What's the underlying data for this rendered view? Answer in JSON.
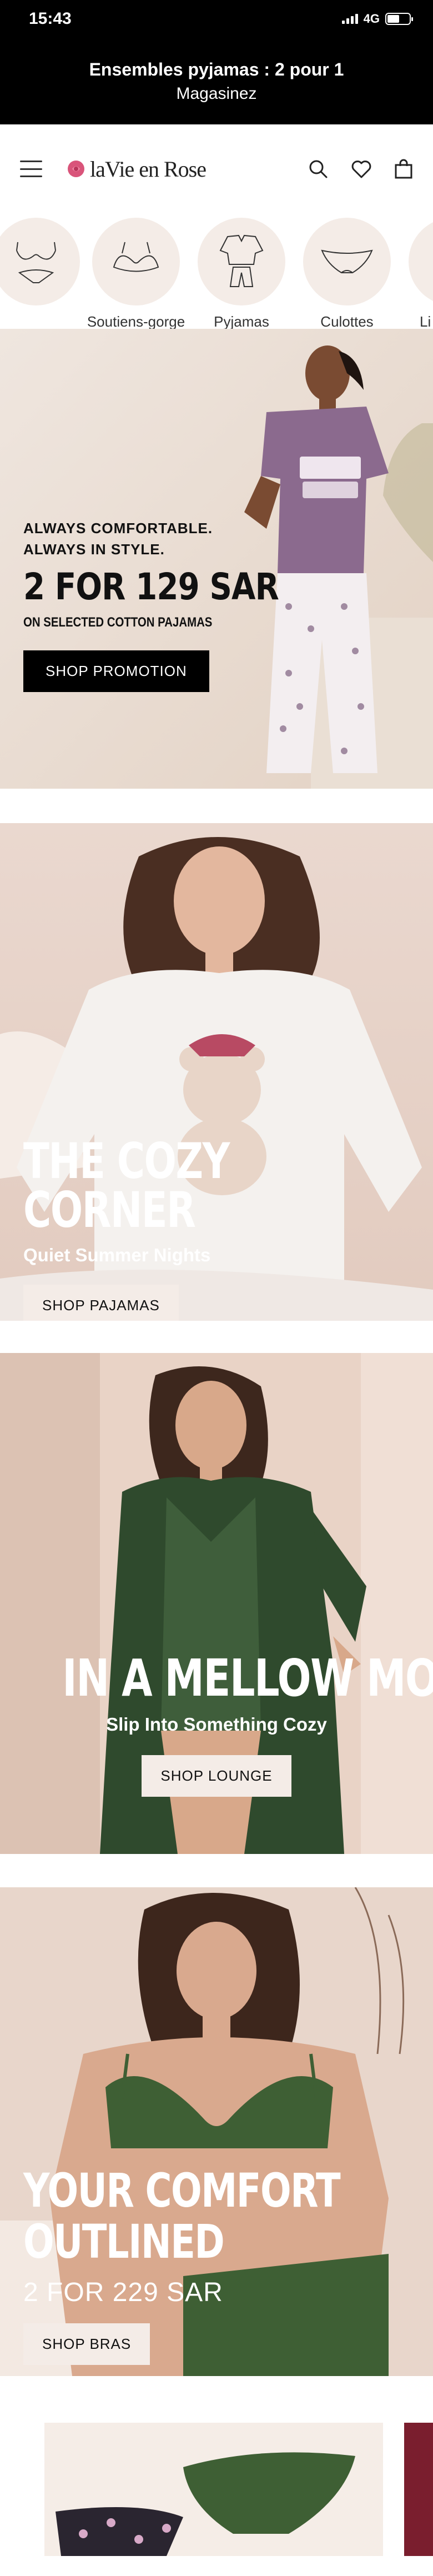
{
  "status_bar": {
    "time": "15:43",
    "network": "4G",
    "battery_level": 0.55
  },
  "promo_banner": {
    "title": "Ensembles pyjamas : 2 pour 1",
    "cta": "Magasinez"
  },
  "header": {
    "logo_text": "laVie en Rose"
  },
  "categories": [
    {
      "label": "",
      "icon": "lingerie-set-icon"
    },
    {
      "label": "Soutiens-gorge",
      "icon": "bra-icon"
    },
    {
      "label": "Pyjamas",
      "icon": "pajamas-icon"
    },
    {
      "label": "Culottes",
      "icon": "panties-icon"
    },
    {
      "label": "Li",
      "icon": "lingerie-icon"
    }
  ],
  "hero1": {
    "eyebrow_1": "ALWAYS COMFORTABLE.",
    "eyebrow_2": "ALWAYS IN STYLE.",
    "headline": "2 FOR 129 SAR",
    "note": "ON SELECTED COTTON PAJAMAS",
    "button": "SHOP PROMOTION"
  },
  "hero2": {
    "headline": "THE COZY CORNER",
    "subtitle": "Quiet Summer Nights",
    "button": "SHOP PAJAMAS"
  },
  "hero3": {
    "headline": "IN A MELLOW MOOD",
    "subtitle": "Slip Into Something Cozy",
    "button": "SHOP LOUNGE"
  },
  "hero4": {
    "headline_1": "YOUR COMFORT",
    "headline_2": "OUTLINED",
    "subtitle": "2 FOR 229 SAR",
    "button": "SHOP BRAS"
  },
  "colors": {
    "brand_rose": "#d9547a",
    "cream": "#f4ece7",
    "black": "#000000"
  }
}
